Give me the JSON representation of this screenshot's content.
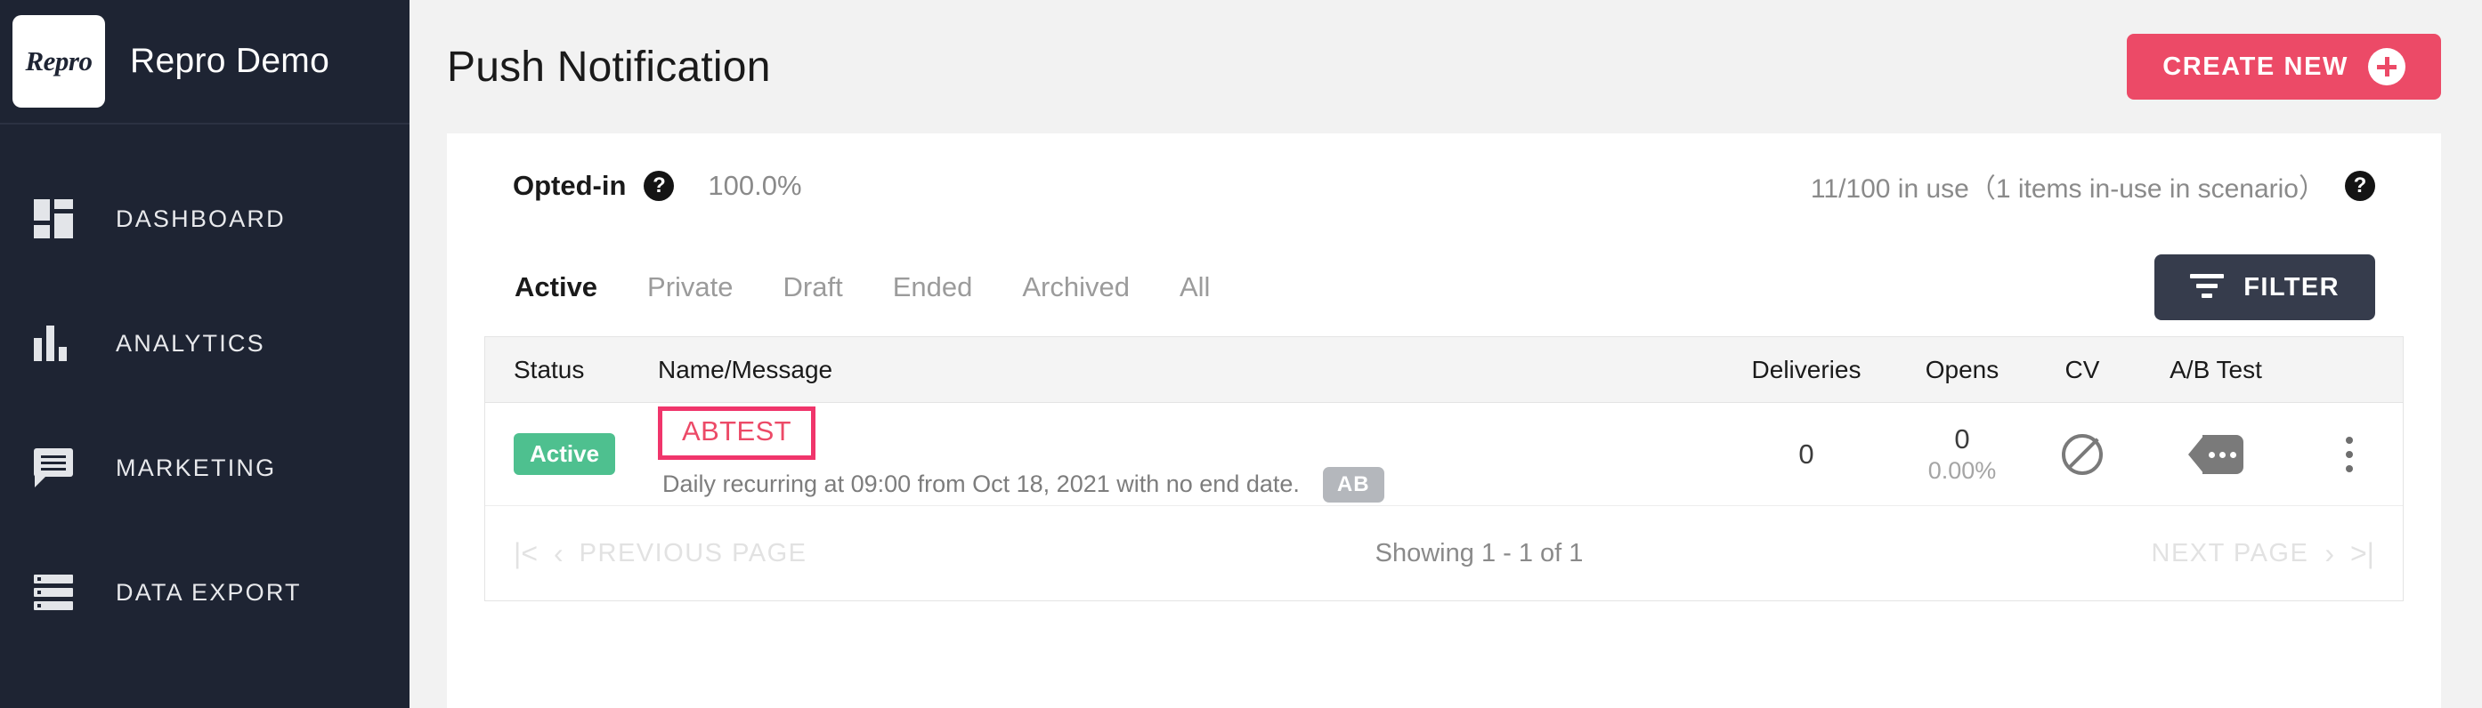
{
  "sidebar": {
    "brand": {
      "logo_text": "Repro",
      "name": "Repro Demo"
    },
    "items": [
      {
        "label": "DASHBOARD",
        "icon": "dashboard-grid-icon"
      },
      {
        "label": "ANALYTICS",
        "icon": "bar-chart-icon"
      },
      {
        "label": "MARKETING",
        "icon": "speech-bubble-icon"
      },
      {
        "label": "DATA EXPORT",
        "icon": "server-list-icon"
      }
    ]
  },
  "header": {
    "title": "Push Notification",
    "create_button": "CREATE NEW"
  },
  "stats": {
    "opted_in_label": "Opted-in",
    "opted_in_help": "?",
    "opted_in_value": "100.0%",
    "usage_text": "11/100 in use（1 items in-use in scenario）",
    "usage_help": "?"
  },
  "tabs": {
    "items": [
      {
        "label": "Active",
        "active": true
      },
      {
        "label": "Private",
        "active": false
      },
      {
        "label": "Draft",
        "active": false
      },
      {
        "label": "Ended",
        "active": false
      },
      {
        "label": "Archived",
        "active": false
      },
      {
        "label": "All",
        "active": false
      }
    ],
    "filter_button": "FILTER"
  },
  "table": {
    "columns": {
      "status": "Status",
      "name": "Name/Message",
      "deliveries": "Deliveries",
      "opens": "Opens",
      "cv": "CV",
      "ab_test": "A/B Test"
    },
    "rows": [
      {
        "status": "Active",
        "name": "ABTEST",
        "message": "Daily recurring at 09:00 from Oct 18, 2021 with no end date.",
        "message_badge": "AB",
        "deliveries": "0",
        "opens": "0",
        "opens_pct": "0.00%",
        "cv_icon": "no-entry-icon",
        "ab_icon": "tag-ellipsis-icon",
        "menu_icon": "kebab-menu-icon"
      }
    ]
  },
  "pagination": {
    "first_icon": "|<",
    "prev_icon": "‹",
    "prev_label": "PREVIOUS PAGE",
    "showing": "Showing 1 - 1 of 1",
    "next_label": "NEXT PAGE",
    "next_icon": "›",
    "last_icon": ">|"
  },
  "colors": {
    "sidebar_bg": "#1e2433",
    "accent_pink": "#ec4a67",
    "highlight_pink": "#f0356b",
    "filter_dark": "#363c4c",
    "status_green": "#4ec08f",
    "ab_badge_gray": "#b4b7bc",
    "page_bg": "#f2f2f2"
  }
}
